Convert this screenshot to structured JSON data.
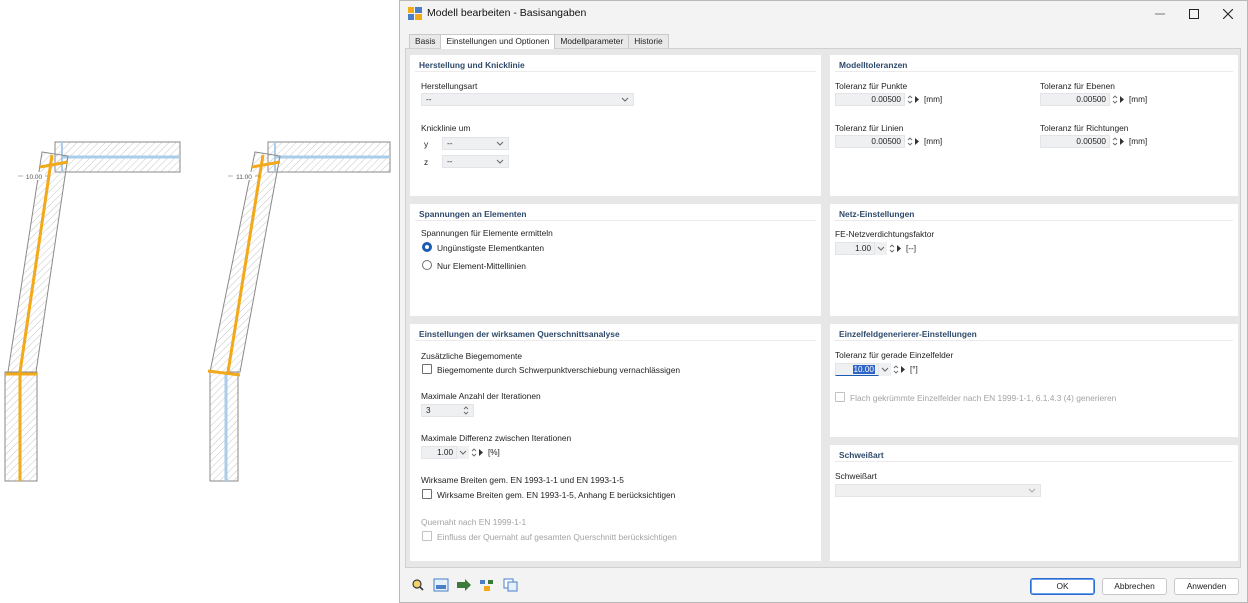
{
  "illustration": {
    "dim_left": "10.00",
    "dim_right": "11.00"
  },
  "window": {
    "title": "Modell bearbeiten - Basisangaben",
    "minimize_glyph": "—",
    "maximize_glyph": "□",
    "close_glyph": "✕"
  },
  "tabs": [
    {
      "label": "Basis"
    },
    {
      "label": "Einstellungen und Optionen"
    },
    {
      "label": "Modellparameter"
    },
    {
      "label": "Historie"
    }
  ],
  "herstellung": {
    "title": "Herstellung und Knicklinie",
    "herstellungsart_label": "Herstellungsart",
    "herstellungsart_value": "--",
    "knicklinie_label": "Knicklinie um",
    "y_label": "y",
    "y_value": "--",
    "z_label": "z",
    "z_value": "--"
  },
  "spannungen": {
    "title": "Spannungen an Elementen",
    "heading": "Spannungen für Elemente ermitteln",
    "option1": "Ungünstigste Elementkanten",
    "option2": "Nur Element-Mittellinien"
  },
  "querschnitt": {
    "title": "Einstellungen der wirksamen Querschnittsanalyse",
    "zus_label": "Zusätzliche Biegemomente",
    "zus_check": "Biegemomente durch Schwerpunktverschiebung vernachlässigen",
    "iter_label": "Maximale Anzahl der Iterationen",
    "iter_value": "3",
    "diff_label": "Maximale Differenz zwischen Iterationen",
    "diff_value": "1.00",
    "diff_unit": "[%]",
    "breiten_label": "Wirksame Breiten gem. EN 1993-1-1 und EN 1993-1-5",
    "breiten_check": "Wirksame Breiten gem. EN 1993-1-5, Anhang E berücksichtigen",
    "quernaht_label": "Quernaht nach EN 1999-1-1",
    "quernaht_check": "Einfluss der Quernaht auf gesamten Querschnitt berücksichtigen"
  },
  "toleranzen": {
    "title": "Modelltoleranzen",
    "punkte_label": "Toleranz für Punkte",
    "punkte_value": "0.00500",
    "ebenen_label": "Toleranz für Ebenen",
    "ebenen_value": "0.00500",
    "linien_label": "Toleranz für Linien",
    "linien_value": "0.00500",
    "richtungen_label": "Toleranz für Richtungen",
    "richtungen_value": "0.00500",
    "unit": "[mm]"
  },
  "netz": {
    "title": "Netz-Einstellungen",
    "faktor_label": "FE-Netzverdichtungsfaktor",
    "faktor_value": "1.00",
    "faktor_unit": "[--]"
  },
  "einzelfeld": {
    "title": "Einzelfeldgenerierer-Einstellungen",
    "tol_label": "Toleranz für gerade Einzelfelder",
    "tol_value": "10.00",
    "tol_unit": "[°]",
    "flach_check": "Flach gekrümmte Einzelfelder nach EN 1999-1-1, 6.1.4.3 (4) generieren"
  },
  "schweiss": {
    "title": "Schweißart",
    "label": "Schweißart",
    "value": ""
  },
  "buttons": {
    "ok": "OK",
    "cancel": "Abbrechen",
    "apply": "Anwenden"
  },
  "colors": {
    "accent": "#1a5cb3",
    "panel_title": "#2e4a6b",
    "orange": "#f2a91a",
    "lightblue": "#a9cdea"
  }
}
